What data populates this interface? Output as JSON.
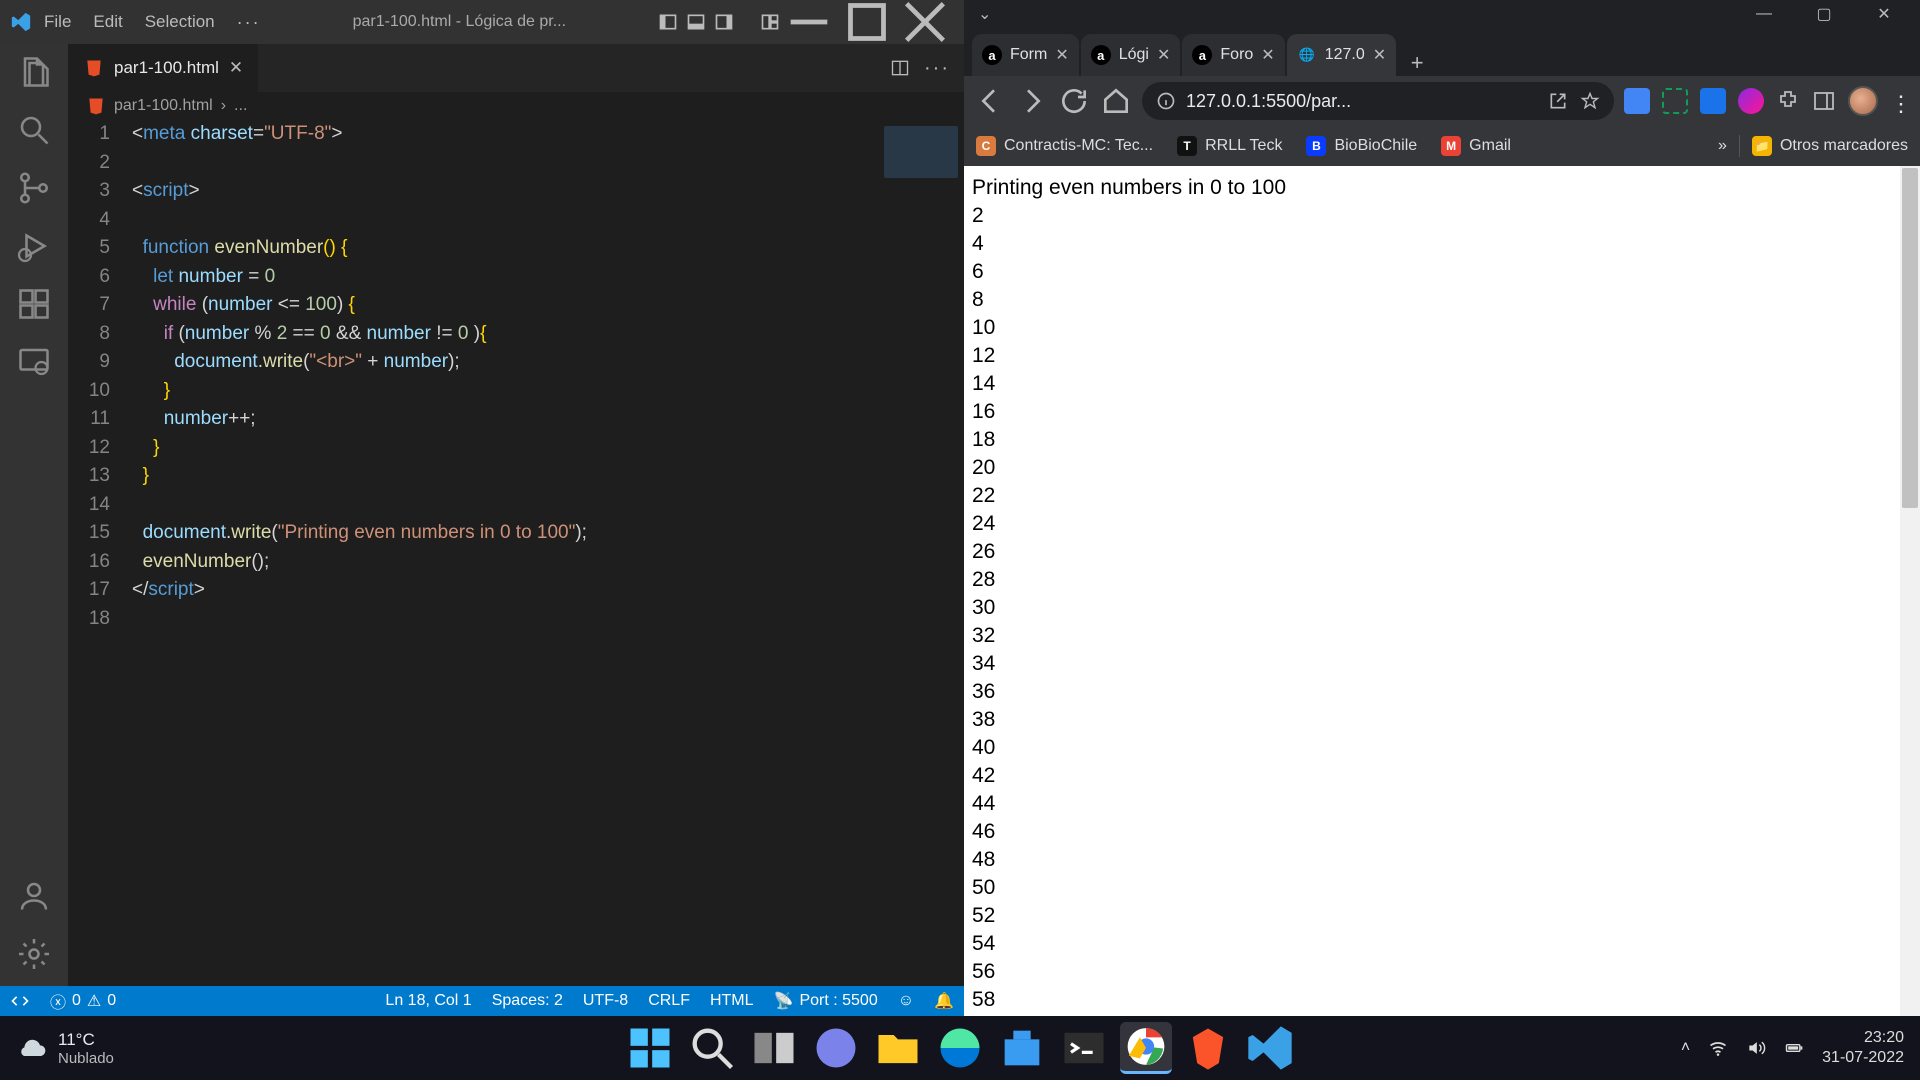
{
  "vscode": {
    "menu": [
      "File",
      "Edit",
      "Selection"
    ],
    "title": "par1-100.html - Lógica de pr...",
    "tab": {
      "name": "par1-100.html"
    },
    "breadcrumb": {
      "file": "par1-100.html",
      "rest": "..."
    },
    "code": [
      {
        "n": 1,
        "html": "<span class='tok-punc'>&lt;</span><span class='tok-tag'>meta</span> <span class='tok-attr'>charset</span><span class='tok-punc'>=</span><span class='tok-str'>\"UTF-8\"</span><span class='tok-punc'>&gt;</span>"
      },
      {
        "n": 2,
        "html": ""
      },
      {
        "n": 3,
        "html": "<span class='tok-punc'>&lt;</span><span class='tok-tag'>script</span><span class='tok-punc'>&gt;</span>"
      },
      {
        "n": 4,
        "html": ""
      },
      {
        "n": 5,
        "html": "  <span class='tok-kw'>function</span> <span class='tok-fn'>evenNumber</span><span class='tok-brkt'>()</span> <span class='tok-brkt'>{</span>"
      },
      {
        "n": 6,
        "html": "    <span class='tok-kw'>let</span> <span class='tok-var'>number</span> <span class='tok-punc'>=</span> <span class='tok-num'>0</span>"
      },
      {
        "n": 7,
        "html": "    <span class='tok-kw2'>while</span> <span class='tok-punc'>(</span><span class='tok-var'>number</span> <span class='tok-punc'>&lt;=</span> <span class='tok-num'>100</span><span class='tok-punc'>)</span> <span class='tok-brkt'>{</span>"
      },
      {
        "n": 8,
        "html": "      <span class='tok-kw2'>if</span> <span class='tok-punc'>(</span><span class='tok-var'>number</span> <span class='tok-punc'>%</span> <span class='tok-num'>2</span> <span class='tok-punc'>==</span> <span class='tok-num'>0</span> <span class='tok-punc'>&amp;&amp;</span> <span class='tok-var'>number</span> <span class='tok-punc'>!=</span> <span class='tok-num'>0</span> <span class='tok-punc'>)</span><span class='tok-brkt'>{</span>"
      },
      {
        "n": 9,
        "html": "        <span class='tok-var'>document</span><span class='tok-punc'>.</span><span class='tok-fn'>write</span><span class='tok-punc'>(</span><span class='tok-str'>\"&lt;br&gt;\"</span> <span class='tok-punc'>+</span> <span class='tok-var'>number</span><span class='tok-punc'>);</span>"
      },
      {
        "n": 10,
        "html": "      <span class='tok-brkt'>}</span>"
      },
      {
        "n": 11,
        "html": "      <span class='tok-var'>number</span><span class='tok-punc'>++;</span>"
      },
      {
        "n": 12,
        "html": "    <span class='tok-brkt'>}</span>"
      },
      {
        "n": 13,
        "html": "  <span class='tok-brkt'>}</span>"
      },
      {
        "n": 14,
        "html": ""
      },
      {
        "n": 15,
        "html": "  <span class='tok-var'>document</span><span class='tok-punc'>.</span><span class='tok-fn'>write</span><span class='tok-punc'>(</span><span class='tok-str'>\"Printing even numbers in 0 to 100\"</span><span class='tok-punc'>);</span>"
      },
      {
        "n": 16,
        "html": "  <span class='tok-fn'>evenNumber</span><span class='tok-punc'>();</span>"
      },
      {
        "n": 17,
        "html": "<span class='tok-punc'>&lt;/</span><span class='tok-tag'>script</span><span class='tok-punc'>&gt;</span>"
      },
      {
        "n": 18,
        "html": ""
      }
    ],
    "status": {
      "remote": "",
      "errors": "0",
      "warnings": "0",
      "lncol": "Ln 18, Col 1",
      "spaces": "Spaces: 2",
      "encoding": "UTF-8",
      "eol": "CRLF",
      "lang": "HTML",
      "port": "Port : 5500"
    }
  },
  "chrome": {
    "tabs": [
      {
        "fav": "a",
        "name": "Form",
        "active": false
      },
      {
        "fav": "a",
        "name": "Lógi",
        "active": false
      },
      {
        "fav": "a",
        "name": "Foro",
        "active": false
      },
      {
        "fav": "globe",
        "name": "127.0",
        "active": true
      }
    ],
    "address": "127.0.0.1:5500/par...",
    "bookmarks": [
      {
        "icon": "C",
        "ibg": "#d97a3e",
        "label": "Contractis-MC: Tec..."
      },
      {
        "icon": "T",
        "ibg": "#111",
        "label": "RRLL Teck"
      },
      {
        "icon": "B",
        "ibg": "#0a3cff",
        "label": "BioBioChile"
      },
      {
        "icon": "M",
        "ibg": "#ea4335",
        "label": "Gmail"
      }
    ],
    "bookmarks_more": "»",
    "bookmarks_other": "Otros marcadores",
    "page": {
      "header": "Printing even numbers in 0 to 100",
      "values": [
        2,
        4,
        6,
        8,
        10,
        12,
        14,
        16,
        18,
        20,
        22,
        24,
        26,
        28,
        30,
        32,
        34,
        36,
        38,
        40,
        42,
        44,
        46,
        48,
        50,
        52,
        54,
        56,
        58
      ]
    }
  },
  "taskbar": {
    "weather_temp": "11°C",
    "weather_desc": "Nublado",
    "clock_time": "23:20",
    "clock_date": "31-07-2022"
  }
}
